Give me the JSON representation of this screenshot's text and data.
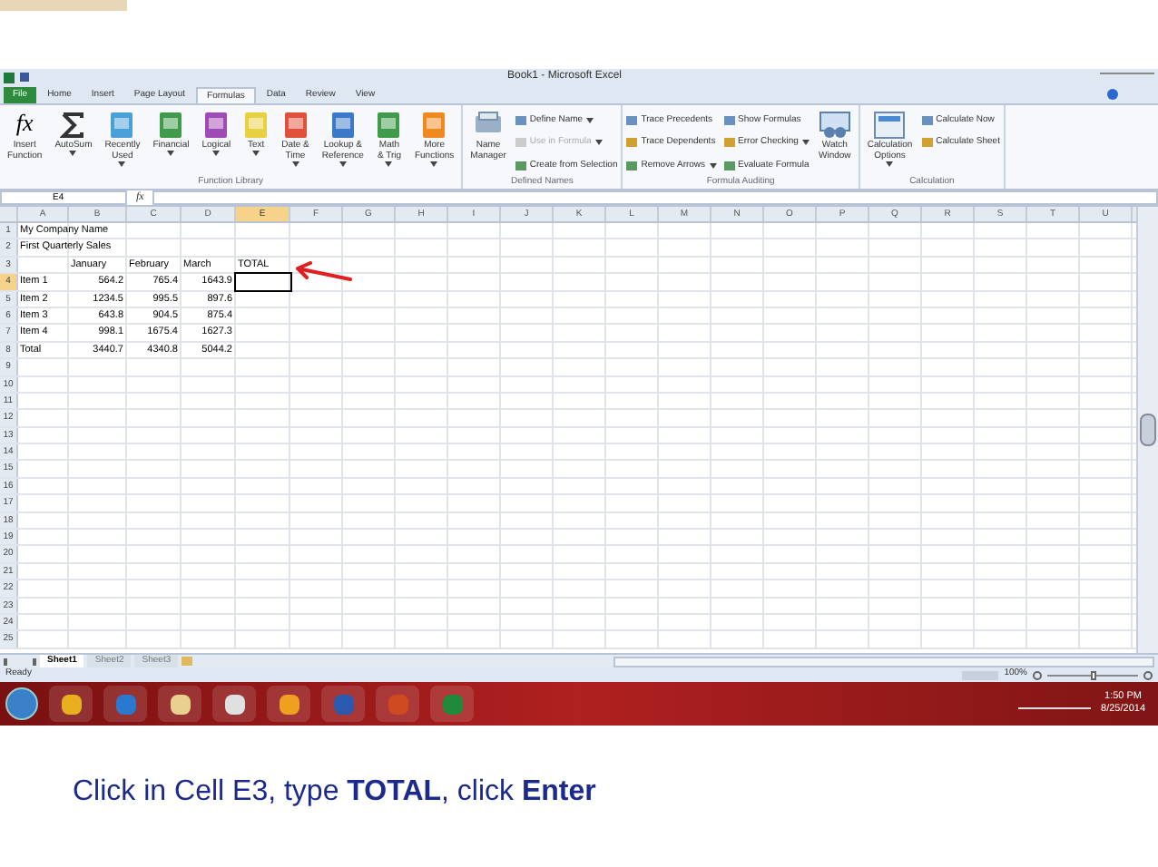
{
  "window": {
    "title": "Book1 - Microsoft Excel"
  },
  "tabs": [
    {
      "label": "File",
      "kind": "file",
      "selected": false
    },
    {
      "label": "Home",
      "kind": "tab",
      "selected": false
    },
    {
      "label": "Insert",
      "kind": "tab",
      "selected": false
    },
    {
      "label": "Page Layout",
      "kind": "tab",
      "selected": false
    },
    {
      "label": "Formulas",
      "kind": "tab",
      "selected": true
    },
    {
      "label": "Data",
      "kind": "tab",
      "selected": false
    },
    {
      "label": "Review",
      "kind": "tab",
      "selected": false
    },
    {
      "label": "View",
      "kind": "tab",
      "selected": false
    }
  ],
  "ribbon": [
    {
      "label": "Function Library",
      "big": [
        {
          "label": "Insert\nFunction",
          "kind": "function",
          "glyph": "fx",
          "dropdown": false
        },
        {
          "label": "AutoSum",
          "kind": "sum",
          "dropdown": true
        },
        {
          "label": "Recently\nUsed",
          "kind": "book",
          "dropdown": true
        },
        {
          "label": "Financial",
          "kind": "book",
          "dropdown": true
        },
        {
          "label": "Logical",
          "kind": "book",
          "dropdown": true
        },
        {
          "label": "Text",
          "kind": "book",
          "dropdown": true
        },
        {
          "label": "Date &\nTime",
          "kind": "book",
          "dropdown": true
        },
        {
          "label": "Lookup &\nReference",
          "kind": "book",
          "dropdown": true
        },
        {
          "label": "Math\n& Trig",
          "kind": "book",
          "dropdown": true
        },
        {
          "label": "More\nFunctions",
          "kind": "book",
          "dropdown": true
        }
      ]
    },
    {
      "label": "Defined Names",
      "big": [
        {
          "label": "Name\nManager",
          "kind": "manager",
          "dropdown": false
        }
      ],
      "small": [
        {
          "label": "Define Name",
          "dropdown": true,
          "disabled": false
        },
        {
          "label": "Use in Formula",
          "dropdown": true,
          "disabled": true
        },
        {
          "label": "Create from Selection",
          "dropdown": false,
          "disabled": false
        }
      ]
    },
    {
      "label": "Formula Auditing",
      "small": [
        {
          "label": "Trace Precedents",
          "dropdown": false,
          "disabled": false
        },
        {
          "label": "Trace Dependents",
          "dropdown": false,
          "disabled": false
        },
        {
          "label": "Remove Arrows",
          "dropdown": true,
          "disabled": false
        },
        {
          "label": "Show Formulas",
          "dropdown": false,
          "disabled": false
        },
        {
          "label": "Error Checking",
          "dropdown": true,
          "disabled": false
        },
        {
          "label": "Evaluate Formula",
          "dropdown": false,
          "disabled": false
        }
      ],
      "after": [
        {
          "label": "Watch\nWindow",
          "kind": "watch",
          "dropdown": false
        }
      ]
    },
    {
      "label": "Calculation",
      "big": [
        {
          "label": "Calculation\nOptions",
          "kind": "calc",
          "dropdown": true
        }
      ],
      "small": [
        {
          "label": "Calculate Now",
          "dropdown": false,
          "disabled": false
        },
        {
          "label": "Calculate Sheet",
          "dropdown": false,
          "disabled": false
        }
      ]
    }
  ],
  "name_box": "E4",
  "formula_bar": {
    "glyph": "fx"
  },
  "columns": [
    {
      "label": "A",
      "selected": false
    },
    {
      "label": "B",
      "selected": false
    },
    {
      "label": "C",
      "selected": false
    },
    {
      "label": "D",
      "selected": false
    },
    {
      "label": "E",
      "selected": true
    },
    {
      "label": "F",
      "selected": false
    },
    {
      "label": "G",
      "selected": false
    },
    {
      "label": "H",
      "selected": false
    },
    {
      "label": "I",
      "selected": false
    },
    {
      "label": "J",
      "selected": false
    },
    {
      "label": "K",
      "selected": false
    },
    {
      "label": "L",
      "selected": false
    },
    {
      "label": "M",
      "selected": false
    },
    {
      "label": "N",
      "selected": false
    },
    {
      "label": "O",
      "selected": false
    },
    {
      "label": "P",
      "selected": false
    },
    {
      "label": "Q",
      "selected": false
    },
    {
      "label": "R",
      "selected": false
    },
    {
      "label": "S",
      "selected": false
    },
    {
      "label": "T",
      "selected": false
    },
    {
      "label": "U",
      "selected": false
    }
  ],
  "rows": [
    {
      "number": "1",
      "selected": false,
      "cells": {
        "A": "My Company Name"
      }
    },
    {
      "number": "2",
      "selected": false,
      "cells": {
        "A": "First Quarterly Sales"
      }
    },
    {
      "number": "3",
      "selected": false,
      "cells": {
        "B": "January",
        "C": "February",
        "D": "March",
        "E": "TOTAL"
      }
    },
    {
      "number": "4",
      "selected": true,
      "cells": {
        "A": "Item 1",
        "B": "564.2",
        "C": "765.4",
        "D": "1643.9"
      }
    },
    {
      "number": "5",
      "selected": false,
      "cells": {
        "A": "Item 2",
        "B": "1234.5",
        "C": "995.5",
        "D": "897.6"
      }
    },
    {
      "number": "6",
      "selected": false,
      "cells": {
        "A": "Item 3",
        "B": "643.8",
        "C": "904.5",
        "D": "875.4"
      }
    },
    {
      "number": "7",
      "selected": false,
      "cells": {
        "A": "Item 4",
        "B": "998.1",
        "C": "1675.4",
        "D": "1627.3"
      }
    },
    {
      "number": "8",
      "selected": false,
      "cells": {
        "A": "Total",
        "B": "3440.7",
        "C": "4340.8",
        "D": "5044.2"
      }
    },
    {
      "number": "9",
      "selected": false
    },
    {
      "number": "10",
      "selected": false
    },
    {
      "number": "11",
      "selected": false
    },
    {
      "number": "12",
      "selected": false
    },
    {
      "number": "13",
      "selected": false
    },
    {
      "number": "14",
      "selected": false
    },
    {
      "number": "15",
      "selected": false
    },
    {
      "number": "16",
      "selected": false
    },
    {
      "number": "17",
      "selected": false
    },
    {
      "number": "18",
      "selected": false
    },
    {
      "number": "19",
      "selected": false
    },
    {
      "number": "20",
      "selected": false
    },
    {
      "number": "21",
      "selected": false
    },
    {
      "number": "22",
      "selected": false
    },
    {
      "number": "23",
      "selected": false
    },
    {
      "number": "24",
      "selected": false
    },
    {
      "number": "25",
      "selected": false
    }
  ],
  "sheet_tabs": [
    {
      "label": "Sheet1",
      "selected": true
    },
    {
      "label": "Sheet2",
      "selected": false
    },
    {
      "label": "Sheet3",
      "selected": false
    }
  ],
  "status_bar": {
    "text": "Ready",
    "zoom": "100%",
    "zoom_slider": {
      "level": 0.5
    }
  },
  "taskbar": {
    "time": "1:50 PM",
    "date": "8/25/2014"
  },
  "caption": "Click in Cell E3, type **TOTAL**, click **Enter**"
}
